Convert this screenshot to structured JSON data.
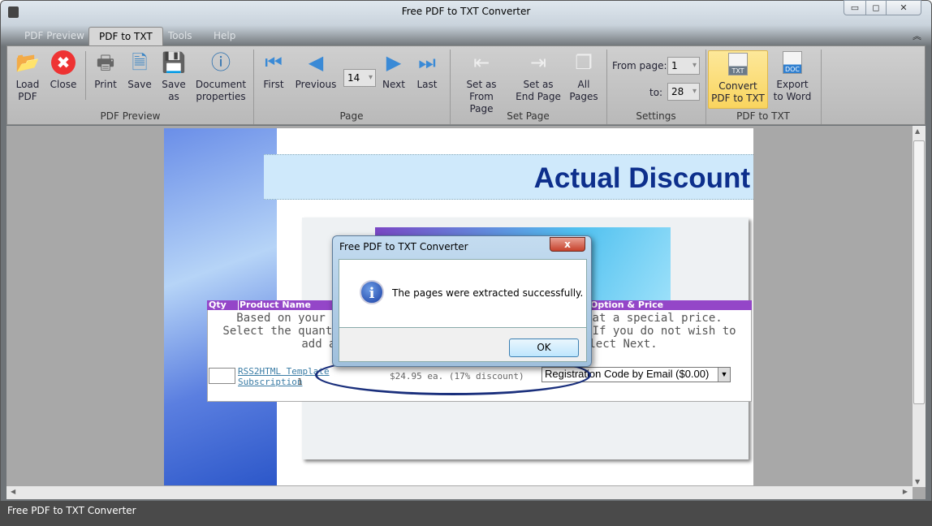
{
  "window": {
    "title": "Free PDF to TXT Converter",
    "minimize": "▭",
    "maximize": "◻",
    "close": "✕",
    "collapse": "︽"
  },
  "tabs": [
    {
      "label": "PDF Preview"
    },
    {
      "label": "PDF to TXT"
    },
    {
      "label": "Tools"
    },
    {
      "label": "Help"
    }
  ],
  "ribbon": {
    "groups": {
      "pdf_preview": "PDF Preview",
      "page": "Page",
      "set_page": "Set Page",
      "settings": "Settings",
      "pdf_to_txt": "PDF to TXT"
    },
    "load": "Load PDF",
    "close": "Close",
    "print": "Print",
    "save": "Save",
    "save_as": "Save as",
    "doc_props": "Document properties",
    "first": "First",
    "previous": "Previous",
    "page_value": "14",
    "next": "Next",
    "last": "Last",
    "set_from": "Set as From Page",
    "set_end": "Set as End Page",
    "all_pages": "All Pages",
    "from_label": "From page:",
    "from_value": "1",
    "to_label": "to:",
    "to_value": "28",
    "convert": "Convert PDF to TXT",
    "export": "Export to Word",
    "txt_badge": "TXT",
    "doc_badge": "DOC"
  },
  "document": {
    "heading": "Actual Discount",
    "table_header": {
      "qty": "Qty",
      "product": "Product Name",
      "option": "Option & Price"
    },
    "body_lines": [
      "Based on your sele                              low at a special price.",
      "Select the quantity                               xt. If you do not wish to",
      "add any                               d select Next."
    ],
    "product_link": "RSS2HTML Template",
    "product_link2": "Subscription",
    "product_qty": "1",
    "price": "$24.95 ea. (17% discount)",
    "select_value": "Registration Code by Email ($0.00)"
  },
  "dialog": {
    "title": "Free PDF to TXT Converter",
    "message": "The pages were extracted successfully.",
    "ok": "OK",
    "close": "x"
  },
  "status": {
    "text": "Free PDF to TXT Converter"
  }
}
